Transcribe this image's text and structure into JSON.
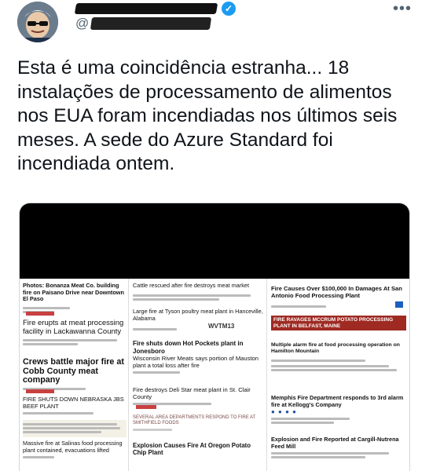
{
  "tweet": {
    "handle_prefix": "@",
    "more_glyph": "•••",
    "verified_glyph": "✓",
    "text": "Esta é uma coincidência estranha... 18 instalações de processamento de alimentos nos EUA foram incendiadas nos últimos seis meses. A sede do Azure Standard foi incendiada ontem."
  },
  "colors": {
    "verified": "#1d9bf0",
    "text": "#0f1419",
    "secondary": "#536471"
  },
  "icons": {
    "avatar": "avatar",
    "verified": "verified-badge-icon",
    "more": "more-horizontal-icon"
  },
  "collage": {
    "col1": [
      "Photos: Bonanza Meat Co. building fire on Paisano Drive near Downtown El Paso",
      "Fire erupts at meat processing facility in Lackawanna County",
      "Crews battle major fire at Cobb County meat company",
      "FIRE SHUTS DOWN NEBRASKA JBS BEEF PLANT",
      "Massive fire at Salinas food processing plant contained, evacuations lifted"
    ],
    "col2": [
      "Cattle rescued after fire destroys meat market",
      "Large fire at Tyson poultry meat plant in Hanceville, Alabama",
      "Fire shuts down Hot Pockets plant in Jonesboro",
      "Wisconsin River Meats says portion of Mauston plant a total loss after fire",
      "Fire destroys Deli Star meat plant in St. Clair County",
      "SEVERAL AREA DEPARTMENTS RESPOND TO FIRE AT SMITHFIELD FOODS",
      "Explosion Causes Fire At Oregon Potato Chip Plant"
    ],
    "col2_logo": "WVTM13",
    "col3": [
      "Fire Causes Over $100,000 In Damages At San Antonio Food Processing Plant",
      "FIRE RAVAGES MCCRUM POTATO PROCESSING PLANT IN BELFAST, MAINE",
      "Multiple alarm fire at food processing operation on Hamilton Mountain",
      "Memphis Fire Department responds to 3rd alarm fire at Kellogg's Company",
      "Explosion and Fire Reported at Cargill-Nutrena Feed Mill"
    ]
  }
}
